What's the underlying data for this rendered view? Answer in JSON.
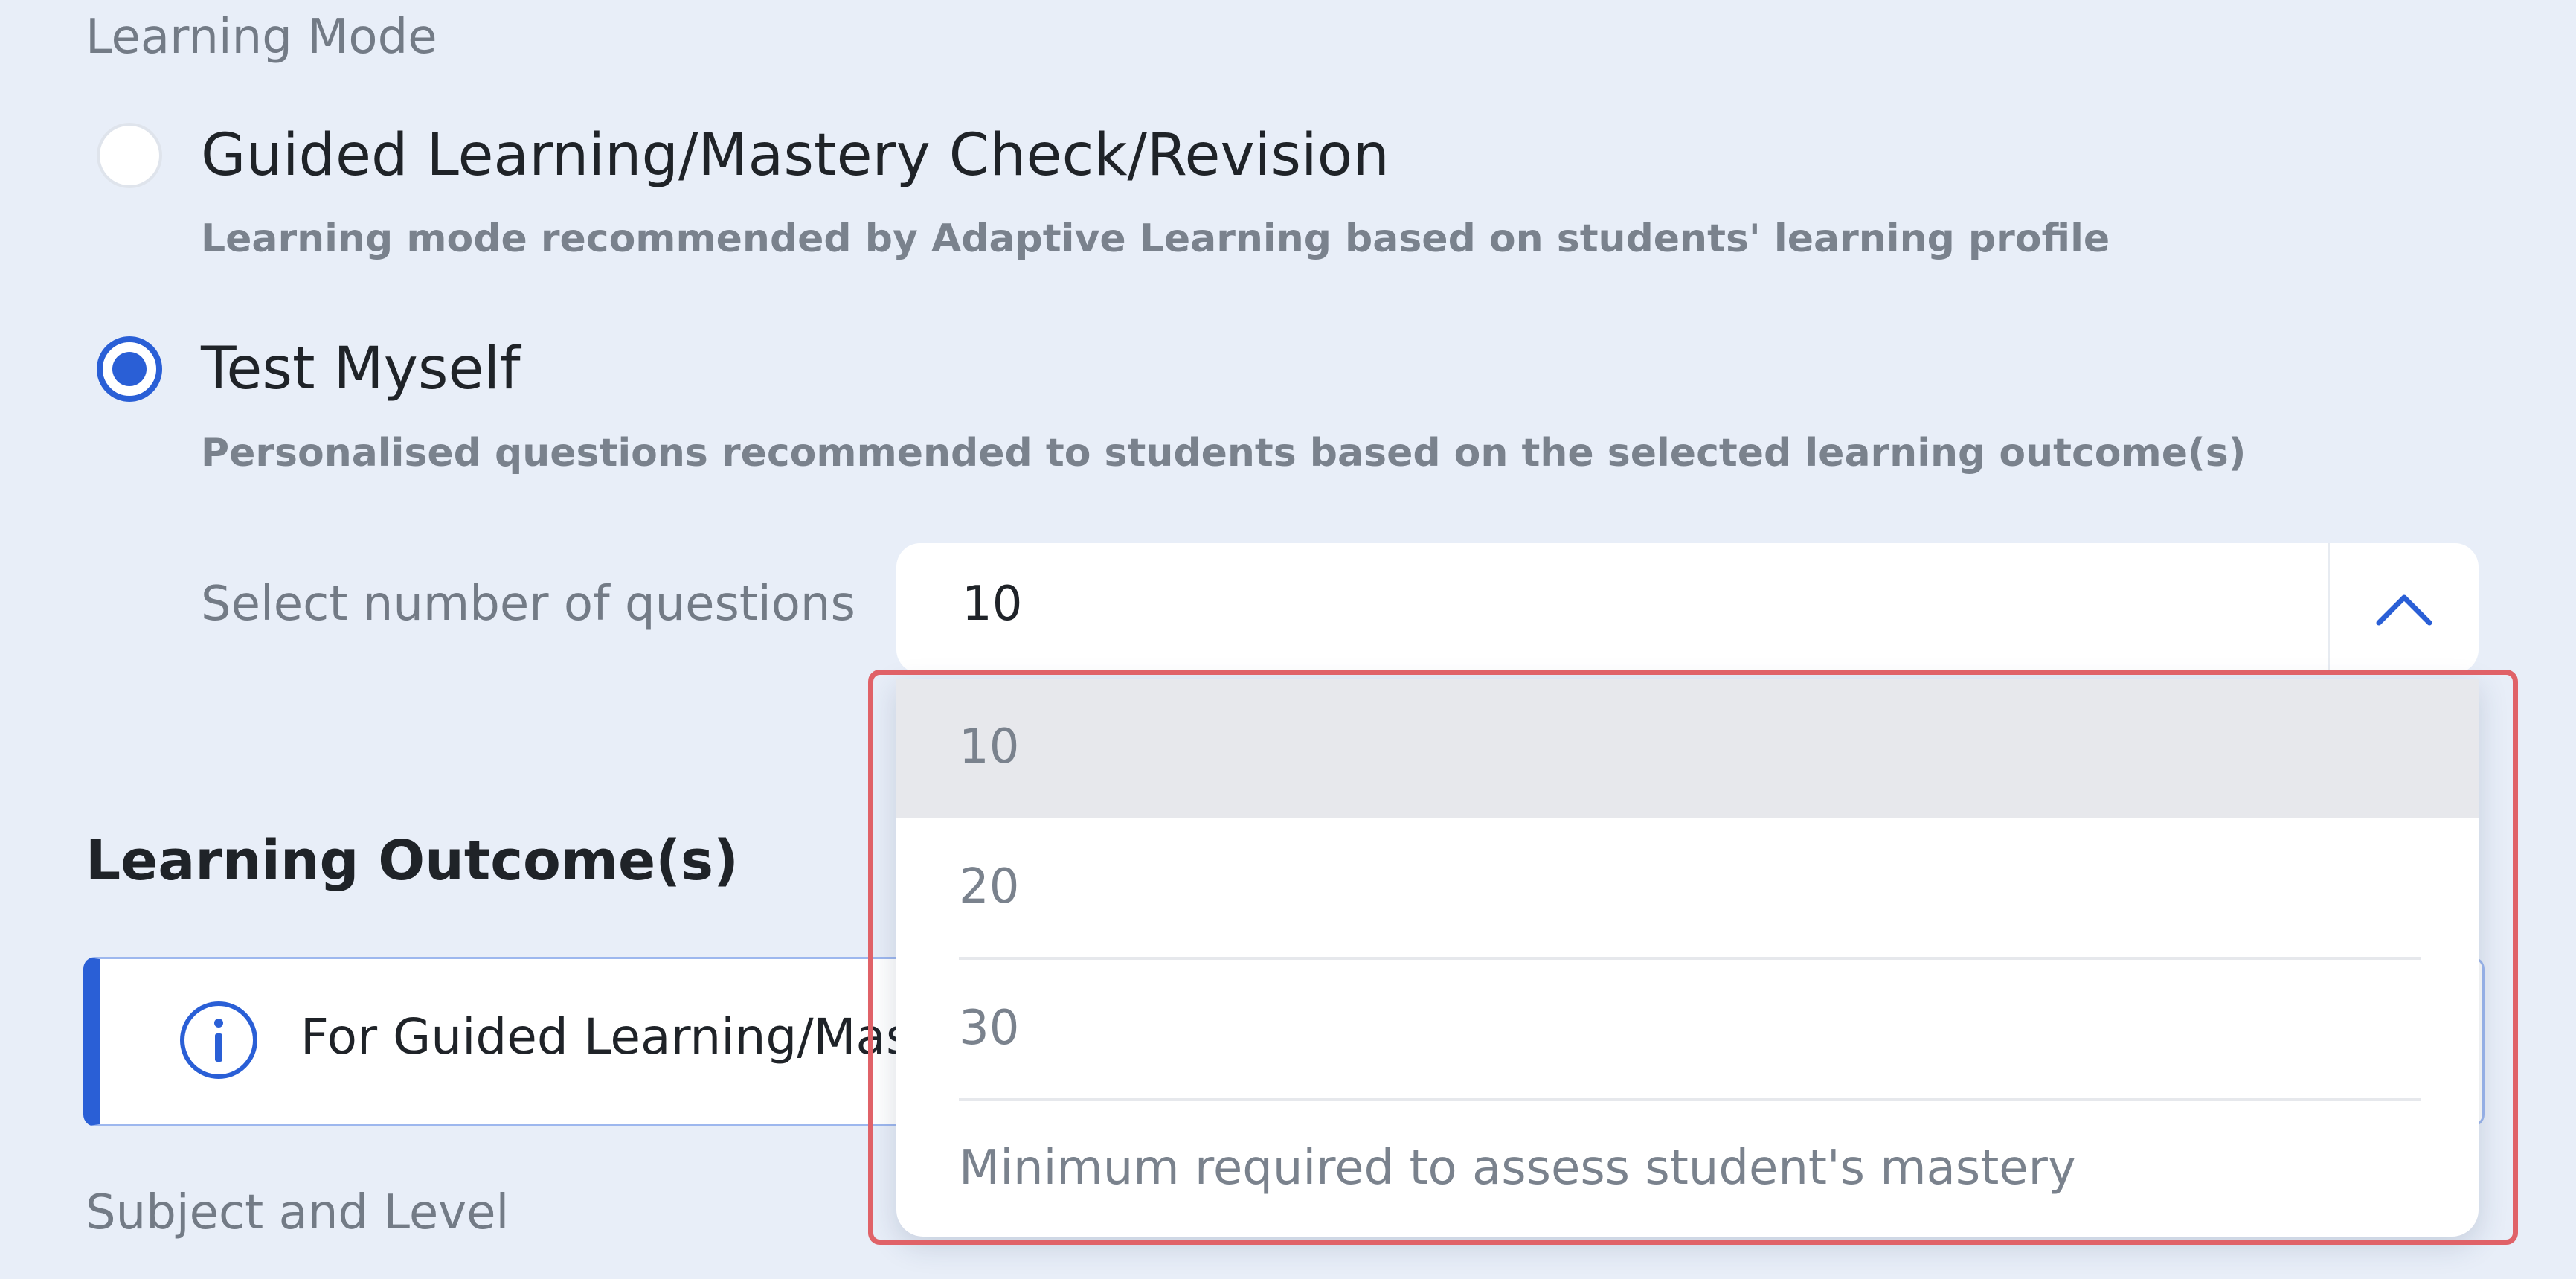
{
  "learning_mode": {
    "label": "Learning Mode",
    "options": [
      {
        "title": "Guided Learning/Mastery Check/Revision",
        "description": "Learning mode recommended by Adaptive Learning based on students' learning profile",
        "selected": false
      },
      {
        "title": "Test Myself",
        "description": "Personalised questions recommended to students based on the selected learning outcome(s)",
        "selected": true
      }
    ]
  },
  "question_count": {
    "label": "Select number of questions",
    "value": "10",
    "toggle_icon": "chevron-up-icon",
    "options": [
      "10",
      "20",
      "30"
    ],
    "highlighted_option": "10",
    "note": "Minimum required to assess student's mastery"
  },
  "learning_outcomes": {
    "heading": "Learning Outcome(s)",
    "info_icon": "info-icon",
    "info_text": "For Guided Learning/Mas"
  },
  "subject_level": {
    "label": "Subject and Level"
  },
  "colors": {
    "background": "#e8eef8",
    "accent": "#2a5fd6",
    "highlight_frame": "#e06268"
  }
}
